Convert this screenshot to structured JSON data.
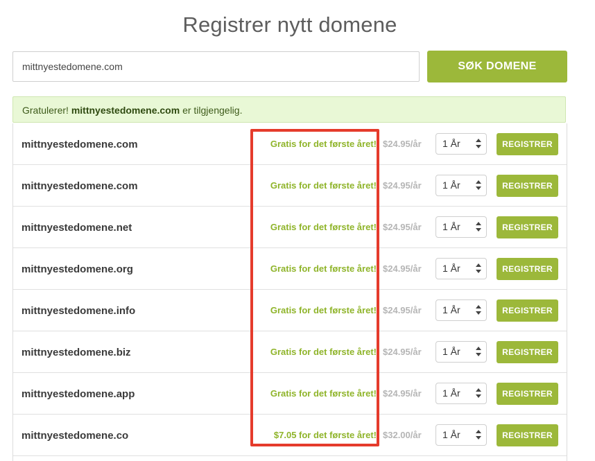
{
  "page": {
    "title": "Registrer nytt domene"
  },
  "search": {
    "value": "mittnyestedomene.com",
    "button_label": "SØK DOMENE"
  },
  "alert": {
    "prefix": "Gratulerer! ",
    "domain": "mittnyestedomene.com",
    "suffix": " er tilgjengelig."
  },
  "results": [
    {
      "domain": "mittnyestedomene.com",
      "promo": "Gratis for det første året!",
      "price": "$24.95/år",
      "period": "1 År",
      "register_label": "REGISTRER"
    },
    {
      "domain": "mittnyestedomene.com",
      "promo": "Gratis for det første året!",
      "price": "$24.95/år",
      "period": "1 År",
      "register_label": "REGISTRER"
    },
    {
      "domain": "mittnyestedomene.net",
      "promo": "Gratis for det første året!",
      "price": "$24.95/år",
      "period": "1 År",
      "register_label": "REGISTRER"
    },
    {
      "domain": "mittnyestedomene.org",
      "promo": "Gratis for det første året!",
      "price": "$24.95/år",
      "period": "1 År",
      "register_label": "REGISTRER"
    },
    {
      "domain": "mittnyestedomene.info",
      "promo": "Gratis for det første året!",
      "price": "$24.95/år",
      "period": "1 År",
      "register_label": "REGISTRER"
    },
    {
      "domain": "mittnyestedomene.biz",
      "promo": "Gratis for det første året!",
      "price": "$24.95/år",
      "period": "1 År",
      "register_label": "REGISTRER"
    },
    {
      "domain": "mittnyestedomene.app",
      "promo": "Gratis for det første året!",
      "price": "$24.95/år",
      "period": "1 År",
      "register_label": "REGISTRER"
    },
    {
      "domain": "mittnyestedomene.co",
      "promo": "$7.05 for det første året!",
      "price": "$32.00/år",
      "period": "1 År",
      "register_label": "REGISTRER"
    }
  ],
  "colors": {
    "accent_green": "#9cb83a",
    "promo_green": "#8fb42a",
    "alert_background": "#e9f8d6",
    "highlight_red": "#e53b2c"
  },
  "icons": {
    "period_select": "chevron-up-down-icon"
  }
}
